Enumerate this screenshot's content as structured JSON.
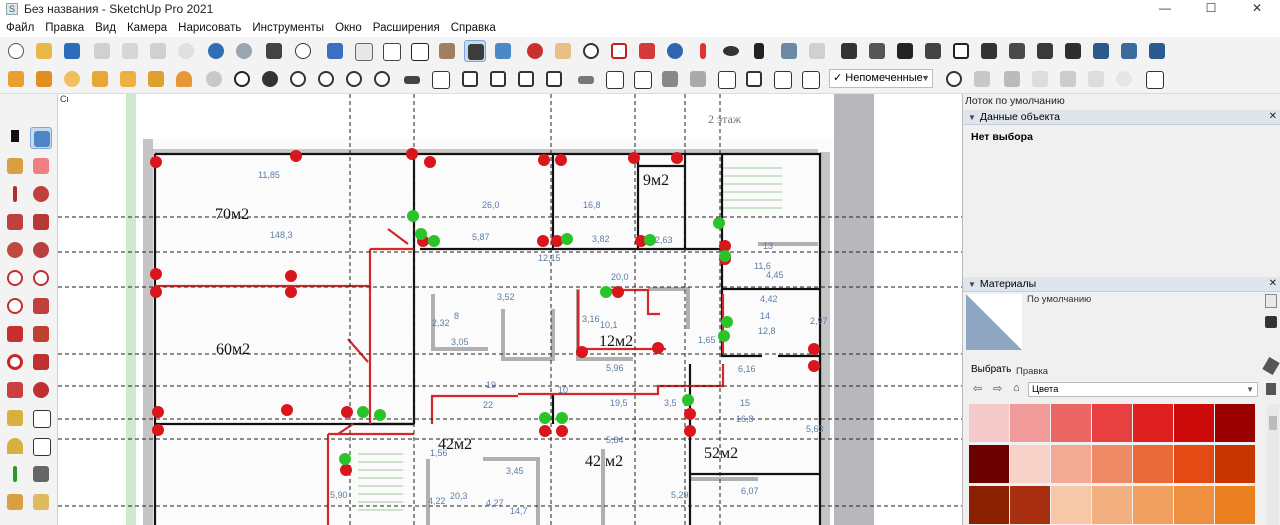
{
  "window": {
    "title": "Без названия - SketchUp Pro 2021",
    "app_icon": "sketchup-logo-icon",
    "minimize": "—",
    "maximize": "☐",
    "close": "✕"
  },
  "menu": [
    "Файл",
    "Правка",
    "Вид",
    "Камера",
    "Нарисовать",
    "Инструменты",
    "Окно",
    "Расширения",
    "Справка"
  ],
  "toolbar": {
    "tag_filter_check": "✓",
    "tag_filter_value": "Непомеченные"
  },
  "viewport": {
    "camera_label": "Сверху",
    "plan_labels": {
      "floor": "2 этаж",
      "area_70": "70м2",
      "area_60": "60м2",
      "area_9": "9м2",
      "area_12": "12м2",
      "area_42a": "42м2",
      "area_42b": "42 м2",
      "area_52": "52м2"
    },
    "dims": [
      "11,85",
      "148,3",
      "26,0",
      "16,8",
      "5,87",
      "3,82",
      "2,63",
      "13",
      "12,15",
      "11,6",
      "4,45",
      "3,52",
      "2,32",
      "8",
      "3,05",
      "20,0",
      "3,16",
      "10,1",
      "4,42",
      "14",
      "12,8",
      "2,97",
      "1,65",
      "6,16",
      "5,96",
      "19",
      "10",
      "19,5",
      "3,5",
      "15",
      "16,8",
      "22",
      "5,84",
      "1,56",
      "3,45",
      "6,07",
      "5,63",
      "5,90",
      "5,29",
      "4,22",
      "4,27",
      "20,3",
      "14,7"
    ]
  },
  "tray": {
    "title": "Лоток по умолчанию",
    "entity_info": {
      "header": "Данные объекта",
      "selection": "Нет выбора"
    },
    "materials": {
      "header": "Материалы",
      "current": "По умолчанию",
      "tab_select": "Выбрать",
      "tab_edit": "Правка",
      "library": "Цвета",
      "swatches": [
        [
          "#f5c9c9",
          "#f19a9a",
          "#ec6666",
          "#e84040",
          "#df2020",
          "#cc0a0a",
          "#9a0000"
        ],
        [
          "#6a0000",
          "#f6d2c8",
          "#f2aa94",
          "#ee8a66",
          "#ea6a3a",
          "#e44a14",
          "#c83600"
        ],
        [
          "#8a2000",
          "#a83010",
          "#f6c8a8",
          "#f2b080",
          "#f0a060",
          "#ee9040",
          "#ea8020"
        ]
      ]
    }
  },
  "colors": {
    "wall": "#111111",
    "red_line": "#d42828",
    "red_dot": "#d9161b",
    "green_dot": "#2ac32a",
    "guide": "#222222"
  }
}
